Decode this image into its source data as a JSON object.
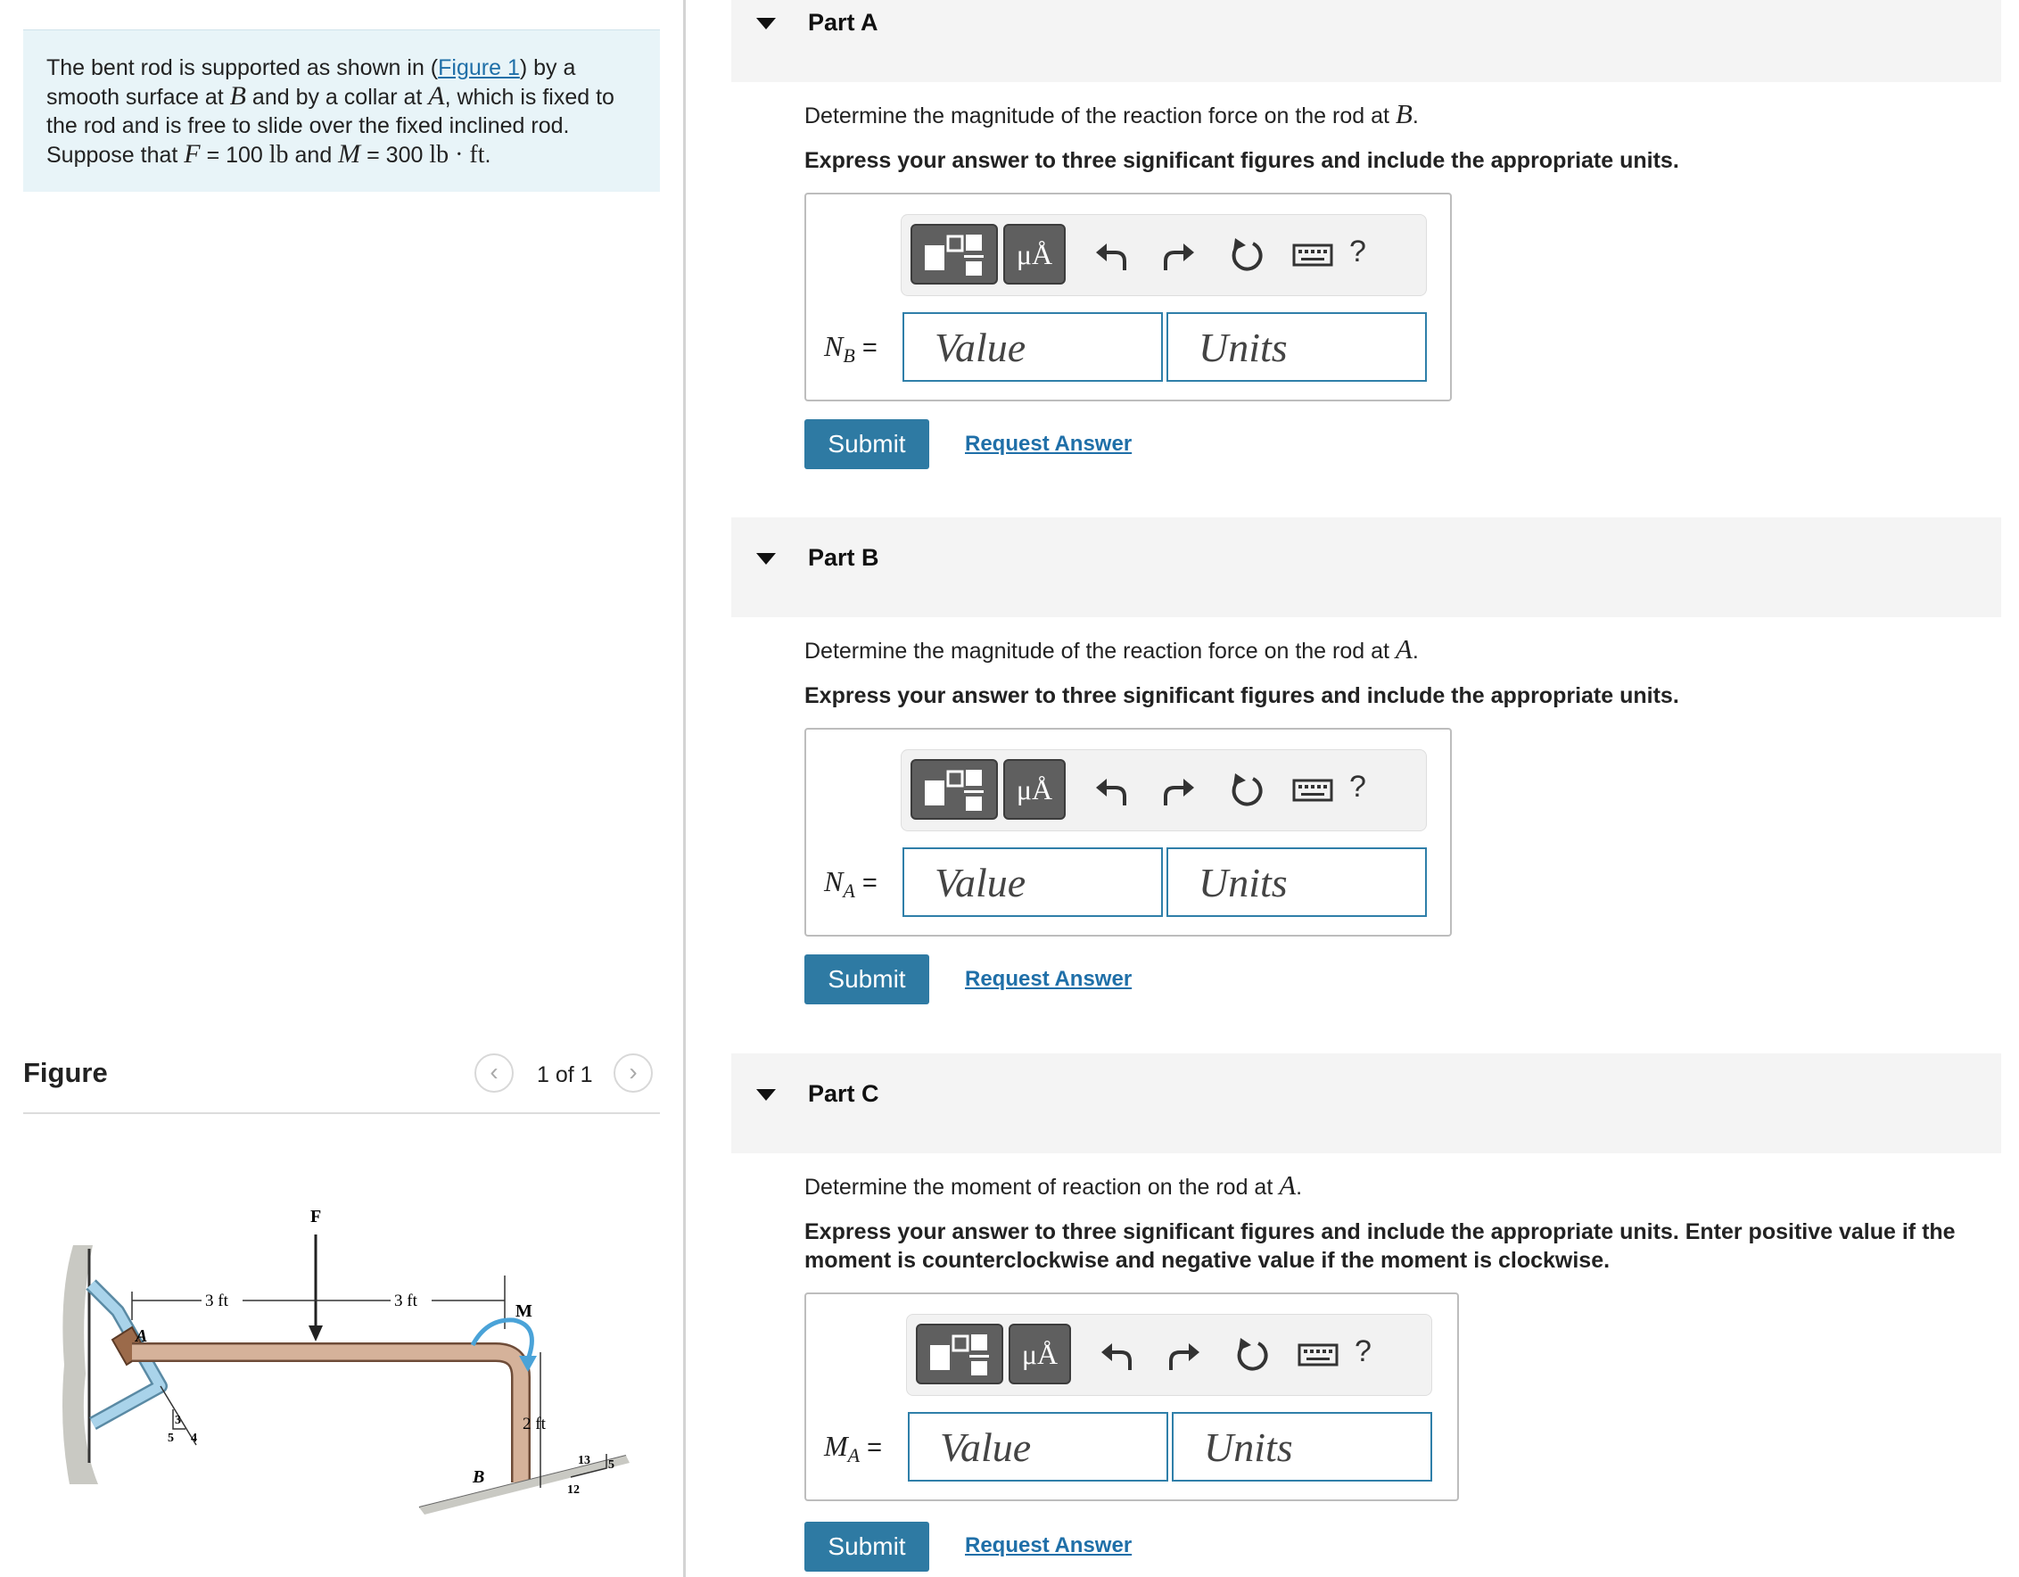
{
  "problem": {
    "t1": "The bent rod is supported as shown in (",
    "figure_link": "Figure 1",
    "t2": ") by a smooth surface at ",
    "B": "B",
    "t3": " and by a collar at ",
    "A": "A",
    "t4": ", which is fixed to the rod and is free to slide over the fixed inclined rod. Suppose that ",
    "F": "F",
    "eq1": " = 100 ",
    "lb": "lb",
    "t5": " and ",
    "M": "M",
    "eq2": " = 300 ",
    "lbft": "lb · ft",
    "t6": "."
  },
  "figure": {
    "title": "Figure",
    "counter": "1 of 1",
    "prev_icon": "‹",
    "next_icon": "›",
    "labels": {
      "F": "F",
      "M": "M",
      "A": "A",
      "B": "B",
      "dim1": "3 ft",
      "dim2": "3 ft",
      "dim3": "2 ft",
      "s3": "3",
      "s4": "4",
      "s5": "5",
      "t13": "13",
      "t12": "12",
      "t5": "5"
    }
  },
  "toolbar": {
    "units_label": "μÅ",
    "help_label": "?",
    "icons": [
      "templates-icon",
      "units-icon",
      "undo-icon",
      "redo-icon",
      "reset-icon",
      "keyboard-icon",
      "help-icon"
    ]
  },
  "parts": [
    {
      "title": "Part A",
      "q_prefix": "Determine the magnitude of the reaction force on the rod at ",
      "q_var": "B",
      "q_suffix": ".",
      "instruction": "Express your answer to three significant figures and include the appropriate units.",
      "var": "N",
      "sub": "B",
      "eq": " =",
      "value_placeholder": "Value",
      "units_placeholder": "Units",
      "submit": "Submit",
      "request": "Request Answer"
    },
    {
      "title": "Part B",
      "q_prefix": "Determine the magnitude of the reaction force on the rod at ",
      "q_var": "A",
      "q_suffix": ".",
      "instruction": "Express your answer to three significant figures and include the appropriate units.",
      "var": "N",
      "sub": "A",
      "eq": " =",
      "value_placeholder": "Value",
      "units_placeholder": "Units",
      "submit": "Submit",
      "request": "Request Answer"
    },
    {
      "title": "Part C",
      "q_prefix": "Determine the moment of reaction on the rod at ",
      "q_var": "A",
      "q_suffix": ".",
      "instruction": "Express your answer to three significant figures and include the appropriate units. Enter positive value if the moment is counterclockwise and negative value if the moment is clockwise.",
      "var": "M",
      "sub": "A",
      "eq": " =",
      "value_placeholder": "Value",
      "units_placeholder": "Units",
      "submit": "Submit",
      "request": "Request Answer"
    }
  ],
  "colors": {
    "accent": "#2e7aa3",
    "link": "#1f6fa8",
    "problem_bg": "#e8f4f8",
    "part_header_bg": "#f4f4f4",
    "rod": "#c8a488",
    "incline_rod": "#8cc3de",
    "moment_arrow": "#4aa3d8"
  }
}
